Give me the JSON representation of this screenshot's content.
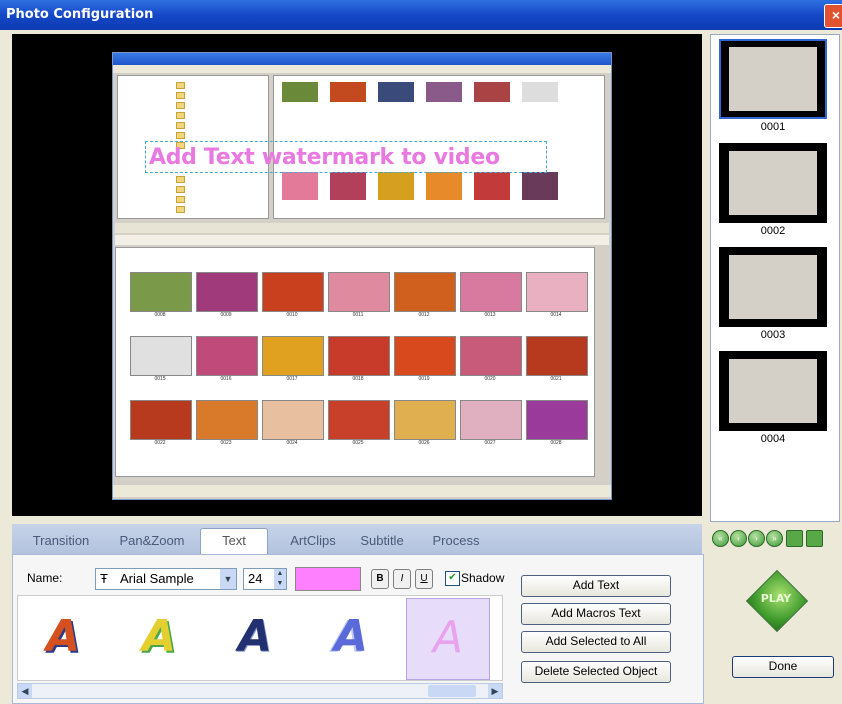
{
  "window": {
    "title": "Photo Configuration",
    "close_label": "×"
  },
  "preview": {
    "watermark_text": "Add Text watermark to video",
    "grid_labels": [
      "0008",
      "0009",
      "0010",
      "0011",
      "0012",
      "0013",
      "0014",
      "0015",
      "0016",
      "0017",
      "0018",
      "0019",
      "0020",
      "0021",
      "0022",
      "0023",
      "0024",
      "0025",
      "0026",
      "0027",
      "0028"
    ]
  },
  "thumbnails": [
    {
      "label": "0001"
    },
    {
      "label": "0002"
    },
    {
      "label": "0003"
    },
    {
      "label": "0004"
    }
  ],
  "tabs": [
    "Transition",
    "Pan&Zoom",
    "Text",
    "ArtClips",
    "Subtitle",
    "Process"
  ],
  "active_tab": "Text",
  "text_panel": {
    "name_label": "Name:",
    "font_name": "Arial  Sample",
    "font_size": "24",
    "text_color": "#ff80ff",
    "bold_label": "B",
    "italic_label": "I",
    "underline_label": "U",
    "shadow_label": "Shadow",
    "shadow_checked": true,
    "style_sample_letter": "A",
    "styles": [
      "style-1",
      "style-2",
      "style-3",
      "style-4",
      "style-5"
    ],
    "selected_style": "style-5"
  },
  "buttons": {
    "add_text": "Add Text",
    "add_macros_text": "Add Macros Text",
    "add_selected_to_all": "Add Selected to All",
    "delete_selected_object": "Delete Selected Object"
  },
  "play_label": "PLAY",
  "done_label": "Done"
}
